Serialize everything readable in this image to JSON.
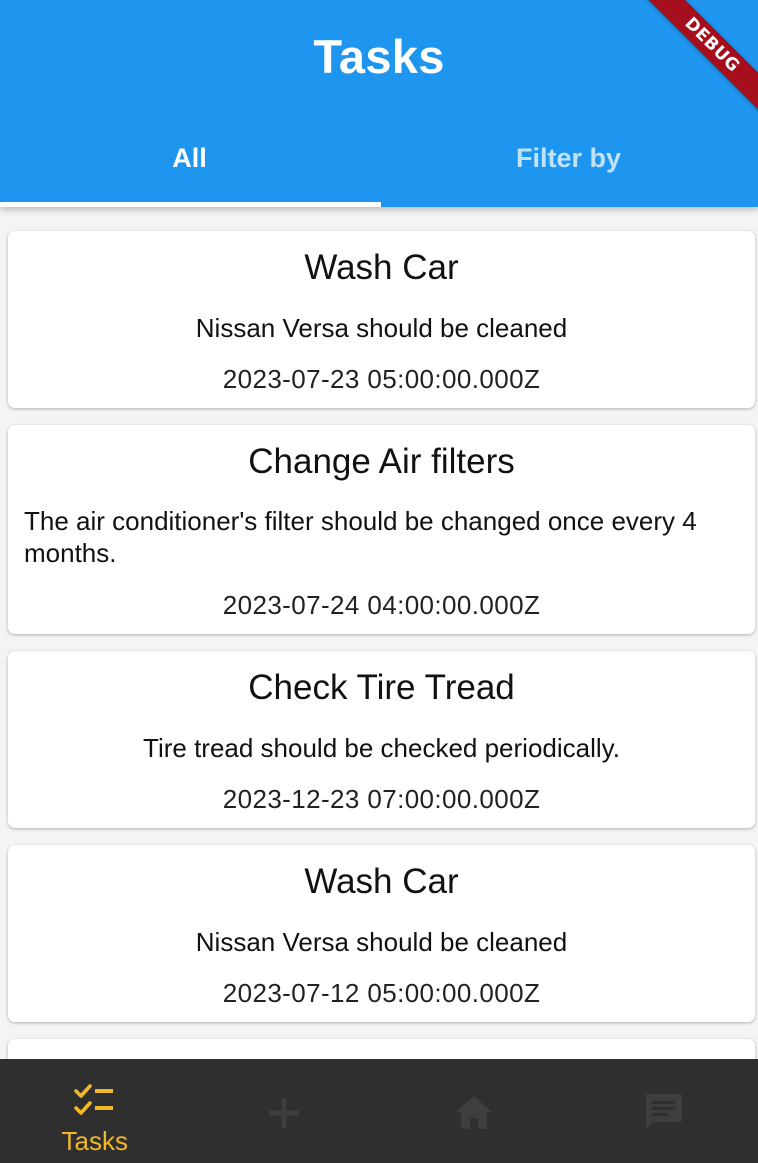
{
  "appbar": {
    "title": "Tasks",
    "tabs": [
      {
        "label": "All",
        "selected": true
      },
      {
        "label": "Filter by",
        "selected": false
      }
    ]
  },
  "debug_banner": "DEBUG",
  "tasks": [
    {
      "title": "Wash Car",
      "description": "Nissan Versa should be cleaned",
      "date": "2023-07-23 05:00:00.000Z"
    },
    {
      "title": "Change Air filters",
      "description": "The air conditioner's filter should be changed once every 4 months.",
      "date": "2023-07-24 04:00:00.000Z"
    },
    {
      "title": "Check Tire Tread",
      "description": "Tire tread should be checked periodically.",
      "date": "2023-12-23 07:00:00.000Z"
    },
    {
      "title": "Wash Car",
      "description": "Nissan Versa should be cleaned",
      "date": "2023-07-12 05:00:00.000Z"
    }
  ],
  "bottom_nav": {
    "items": [
      {
        "label": "Tasks",
        "icon": "checklist-icon",
        "active": true
      },
      {
        "label": "",
        "icon": "add-icon",
        "active": false
      },
      {
        "label": "",
        "icon": "home-icon",
        "active": false
      },
      {
        "label": "",
        "icon": "chat-icon",
        "active": false
      }
    ]
  },
  "colors": {
    "primary": "#1e96f0",
    "accent": "#f2b827",
    "nav_background": "#2f2f2f",
    "nav_inactive": "#3e3e3e",
    "debug_ribbon": "#a50e1d"
  }
}
